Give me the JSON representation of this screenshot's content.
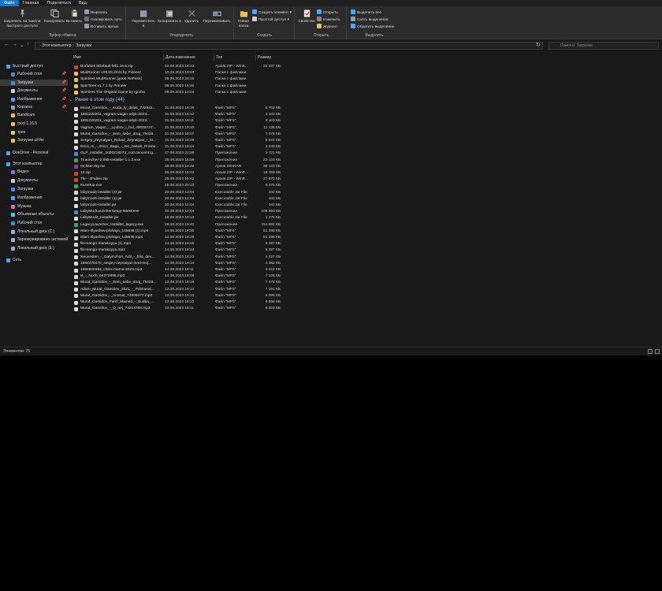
{
  "menu": {
    "tabs": [
      "Файл",
      "Главная",
      "Поделиться",
      "Вид"
    ],
    "active": 0
  },
  "ribbon": {
    "clipboard": {
      "group": "Буфер обмена",
      "pin": "Закрепить на панели быстрого доступа",
      "copy": "Копировать",
      "paste": "Вставить",
      "cut": "Вырезать",
      "copy_path": "Скопировать путь",
      "paste_shortcut": "Вставить ярлык"
    },
    "organize": {
      "group": "Упорядочить",
      "move_to": "Переместить в",
      "copy_to": "Копировать в",
      "delete": "Удалить",
      "rename": "Переименовать"
    },
    "create": {
      "group": "Создать",
      "new_folder": "Новая папка",
      "new_item": "Создать элемент ▾",
      "easy_access": "Простой доступ ▾"
    },
    "open": {
      "group": "Открыть",
      "properties": "Свойства",
      "open": "Открыть",
      "edit": "Изменить",
      "history": "Журнал"
    },
    "select": {
      "group": "Выделить",
      "select_all": "Выделить все",
      "select_none": "Снять выделение",
      "invert": "Обратить выделение"
    }
  },
  "address": {
    "back": "←",
    "forward": "→",
    "down": "⌄",
    "up": "↑",
    "path": [
      "Этот компьютер",
      "Загрузки"
    ],
    "refresh": "↻",
    "search_placeholder": "Поиск в: Загрузки"
  },
  "nav": {
    "items": [
      {
        "label": "Быстрый доступ",
        "level": 0,
        "color": "#4aa3ff",
        "pin": ""
      },
      {
        "label": "Рабочий стол",
        "level": 1,
        "color": "#3b8fd9",
        "pin": "📌"
      },
      {
        "label": "Загрузки",
        "level": 1,
        "color": "#3b8fd9",
        "pin": "📌",
        "selected": true
      },
      {
        "label": "Документы",
        "level": 1,
        "color": "#cfcfcf",
        "pin": "📌"
      },
      {
        "label": "Изображения",
        "level": 1,
        "color": "#4aa3ff",
        "pin": "📌"
      },
      {
        "label": "Корзина",
        "level": 1,
        "color": "#8aa0b8",
        "pin": "📌"
      },
      {
        "label": "Bandicam",
        "level": 1,
        "color": "#e8c15a",
        "pin": ""
      },
      {
        "label": "mod 1.16.5",
        "level": 1,
        "color": "#e8c15a",
        "pin": ""
      },
      {
        "label": "трек",
        "level": 1,
        "color": "#e8c15a",
        "pin": ""
      },
      {
        "label": "Загрузки uFiler",
        "level": 1,
        "color": "#e8c15a",
        "pin": ""
      },
      {
        "label": "OneDrive - Personal",
        "level": 0,
        "color": "#4aa3ff",
        "pin": ""
      },
      {
        "label": "Этот компьютер",
        "level": 0,
        "color": "#4aa3ff",
        "pin": ""
      },
      {
        "label": "Видео",
        "level": 1,
        "color": "#8a6fd6",
        "pin": ""
      },
      {
        "label": "Документы",
        "level": 1,
        "color": "#cfcfcf",
        "pin": ""
      },
      {
        "label": "Загрузки",
        "level": 1,
        "color": "#3b8fd9",
        "pin": ""
      },
      {
        "label": "Изображения",
        "level": 1,
        "color": "#4aa3ff",
        "pin": ""
      },
      {
        "label": "Музыка",
        "level": 1,
        "color": "#e06fa8",
        "pin": ""
      },
      {
        "label": "Объемные объекты",
        "level": 1,
        "color": "#4ac6e8",
        "pin": ""
      },
      {
        "label": "Рабочий стол",
        "level": 1,
        "color": "#3b8fd9",
        "pin": ""
      },
      {
        "label": "Локальный диск (C:)",
        "level": 1,
        "color": "#9ab0c8",
        "pin": ""
      },
      {
        "label": "Зарезервировано системой",
        "level": 1,
        "color": "#9ab0c8",
        "pin": ""
      },
      {
        "label": "Локальный диск (E:)",
        "level": 1,
        "color": "#9ab0c8",
        "pin": ""
      },
      {
        "label": "Сеть",
        "level": 0,
        "color": "#4aa3ff",
        "pin": ""
      }
    ]
  },
  "columns": {
    "name": "Имя",
    "date": "Дата изменения",
    "type": "Тип",
    "size": "Размер"
  },
  "group_earlier": "Ранее в этом году (44)",
  "files_top": [
    {
      "name": "Borfukes 8Default fell1.16.5.zip",
      "date": "02.09.2023 18:23",
      "type": "Архив ZIP - WinR...",
      "size": "22 237 КБ",
      "icon": "#c9452e"
    },
    {
      "name": "MudRunner v28.09.2022 by Pioneer",
      "date": "10.09.2023 19:03",
      "type": "Папка с файлами",
      "size": "",
      "icon": "#e8c15a"
    },
    {
      "name": "Spintires MudRunner [qoob RePack]",
      "date": "09.09.2023 23:15",
      "type": "Папка с файлами",
      "size": "",
      "icon": "#e8c15a"
    },
    {
      "name": "SpinTires v1.7.1 by Pioneer",
      "date": "09.09.2023 15:40",
      "type": "Папка с файлами",
      "size": "",
      "icon": "#e8c15a"
    },
    {
      "name": "Spintires The Original Game by Igruha",
      "date": "09.09.2023 14:04",
      "type": "Папка с файлами",
      "size": "",
      "icon": "#e8c15a"
    }
  ],
  "files_earlier": [
    {
      "name": "Murat_Gamidov_-_Kuda_ty_delas_732642...",
      "date": "31.08.2023 18:16",
      "type": "Файл \"MP3\"",
      "size": "6 703 КБ",
      "icon": "#d9d9d9"
    },
    {
      "name": "1691220201_vagram-vaqan-odyk-2023...",
      "date": "31.08.2023 19:12",
      "type": "Файл \"MP3\"",
      "size": "3 103 КБ",
      "icon": "#d9d9d9"
    },
    {
      "name": "1691220201_vagram-vaqan-odyk-2023...",
      "date": "31.08.2023 19:11",
      "type": "Файл \"MP3\"",
      "size": "3 103 КБ",
      "icon": "#d9d9d9"
    },
    {
      "name": "Vagram_Vaqan_-_Lyubov_i_bol_48005747...",
      "date": "31.08.2023 19:10",
      "type": "Файл \"MP3\"",
      "size": "11 136 КБ",
      "icon": "#d9d9d9"
    },
    {
      "name": "Murat_Gamidov_-_Sem_sebe_drug_75428...",
      "date": "31.08.2023 19:07",
      "type": "Файл \"MP3\"",
      "size": "7 476 КБ",
      "icon": "#d9d9d9"
    },
    {
      "name": "Sergey_Zeynalyan_Rafael_Zeynalyan_-_N...",
      "date": "31.08.2023 18:49",
      "type": "Файл \"MP3\"",
      "size": "5 522 КБ",
      "icon": "#d9d9d9"
    },
    {
      "name": "Esco_m_-_Esco_Baga_-_Ne_zakale_Preme...",
      "date": "31.08.2023 18:44",
      "type": "Файл \"MP3\"",
      "size": "3 049 КБ",
      "icon": "#d9d9d9"
    },
    {
      "name": "GLP_installer_1000218273_com.tencent.ig...",
      "date": "27.08.2023 21:58",
      "type": "Приложение",
      "size": "3 721 КБ",
      "icon": "#3b8fd9"
    },
    {
      "name": "TLauncher-2.885-Installer-1.1.3.exe",
      "date": "26.08.2023 15:59",
      "type": "Приложение",
      "size": "23 123 КБ",
      "icon": "#3ba84a"
    },
    {
      "name": "mr.blue.sky.rar",
      "date": "26.08.2023 15:46",
      "type": "Архив WinRAR",
      "size": "38 133 КБ",
      "icon": "#8a3fa8"
    },
    {
      "name": "12.zip",
      "date": "26.08.2023 15:42",
      "type": "Архив ZIP - WinR...",
      "size": "18 459 КБ",
      "icon": "#c9452e"
    },
    {
      "name": "7fe---4Fallen.zip",
      "date": "26.08.2023 15:42",
      "type": "Архив ZIP - WinR...",
      "size": "27 870 КБ",
      "icon": "#c9452e"
    },
    {
      "name": "KLSetup.exe",
      "date": "25.08.2023 20:13",
      "type": "Приложение",
      "size": "8 375 КБ",
      "icon": "#3ba84a"
    },
    {
      "name": "labymod4-installer (2).jar",
      "date": "20.08.2023 12:04",
      "type": "Executable Jar File",
      "size": "342 КБ",
      "icon": "#d9d9d9"
    },
    {
      "name": "labymod4-installer (1).jar",
      "date": "20.08.2023 12:04",
      "type": "Executable Jar File",
      "size": "342 КБ",
      "icon": "#d9d9d9"
    },
    {
      "name": "labymod4-installer.jar",
      "date": "20.08.2023 12:04",
      "type": "Executable Jar File",
      "size": "342 КБ",
      "icon": "#d9d9d9"
    },
    {
      "name": "LabyModLauncherSetup-latest.exe",
      "date": "20.08.2023 12:04",
      "type": "Приложение",
      "size": "106 993 КБ",
      "icon": "#3b8fd9"
    },
    {
      "name": "LabyMod3_Installer.jar",
      "date": "18.08.2023 16:13",
      "type": "Executable Jar File",
      "size": "1 276 КБ",
      "icon": "#d9d9d9"
    },
    {
      "name": "LegacyLauncher_Installer_legacy.exe",
      "date": "18.08.2023 15:40",
      "type": "Приложение",
      "size": "114 992 КБ",
      "icon": "#3ba84a"
    },
    {
      "name": "islam-itlyashev-plohaya_145636 (1).mp4",
      "date": "14.08.2023 18:30",
      "type": "Файл \"MP4\"",
      "size": "51 296 КБ",
      "icon": "#d9d9d9"
    },
    {
      "name": "islam-itlyashev-plohaya_145636.mp4",
      "date": "14.08.2023 18:28",
      "type": "Файл \"MP4\"",
      "size": "51 296 КБ",
      "icon": "#d9d9d9"
    },
    {
      "name": "flit-mango-marakuyya (1).mp3",
      "date": "14.08.2023 18:25",
      "type": "Файл \"MP3\"",
      "size": "5 297 КБ",
      "icon": "#d9d9d9"
    },
    {
      "name": "flit-mango-marakuyya.mp3",
      "date": "14.08.2023 18:24",
      "type": "Файл \"MP3\"",
      "size": "5 297 КБ",
      "icon": "#d9d9d9"
    },
    {
      "name": "Neuvesten_-_Galymzhan_Adil_-_Elia_dev...",
      "date": "14.08.2023 18:23",
      "type": "Файл \"MP3\"",
      "size": "4 427 КБ",
      "icon": "#d9d9d9"
    },
    {
      "name": "1684475470_sergey-zeynalyan-brat-moj...",
      "date": "14.08.2023 18:14",
      "type": "Файл \"MP3\"",
      "size": "3 382 КБ",
      "icon": "#d9d9d9"
    },
    {
      "name": "1684820382_chiko-mama-2023.mp3",
      "date": "14.08.2023 18:11",
      "type": "Файл \"MP3\"",
      "size": "3 222 КБ",
      "icon": "#d9d9d9"
    },
    {
      "name": "И_-_Noch_64373998.mp3",
      "date": "14.08.2023 18:08",
      "type": "Файл \"MP3\"",
      "size": "7 226 КБ",
      "icon": "#d9d9d9"
    },
    {
      "name": "Murat_Gamidov_-_Sem_sebe_drug_75428...",
      "date": "13.08.2023 18:19",
      "type": "Файл \"MP3\"",
      "size": "7 476 КБ",
      "icon": "#d9d9d9"
    },
    {
      "name": "Adam_Murat_Gamidov_2021_-_Pidmanal...",
      "date": "13.08.2023 18:14",
      "type": "Файл \"MP3\"",
      "size": "7 191 КБ",
      "icon": "#d9d9d9"
    },
    {
      "name": "Murat_Gamidov_-_Aromat_74809477.mp3",
      "date": "13.08.2023 18:13",
      "type": "Файл \"MP3\"",
      "size": "6 085 КБ",
      "icon": "#d9d9d9"
    },
    {
      "name": "Murat_Gamidov_Fariz_Mamed_-_Sudba_...",
      "date": "13.08.2023 18:12",
      "type": "Файл \"MP3\"",
      "size": "6 858 КБ",
      "icon": "#d9d9d9"
    },
    {
      "name": "Murat_Gamidov_-_O_nej_74213768.mp3",
      "date": "13.08.2023 18:11",
      "type": "Файл \"MP3\"",
      "size": "6 303 КБ",
      "icon": "#d9d9d9"
    }
  ],
  "status": {
    "count": "Элементов: 75"
  }
}
